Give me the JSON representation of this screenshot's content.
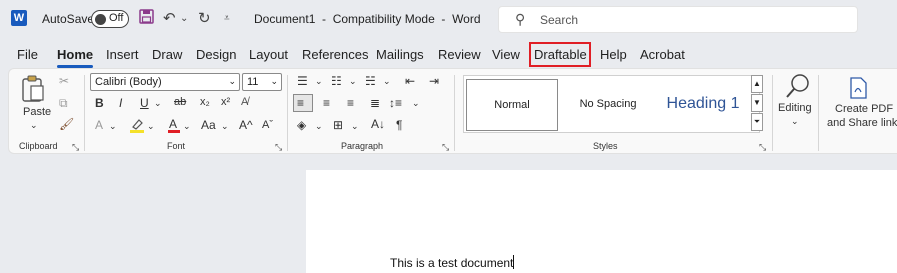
{
  "titlebar": {
    "app_icon_letter": "W",
    "autosave_label": "AutoSave",
    "autosave_state": "Off",
    "document_title": "Document1  -  Compatibility Mode  -  Word",
    "search_placeholder": "Search"
  },
  "tabs": [
    "File",
    "Home",
    "Insert",
    "Draw",
    "Design",
    "Layout",
    "References",
    "Mailings",
    "Review",
    "View",
    "Draftable",
    "Help",
    "Acrobat"
  ],
  "active_tab": "Home",
  "highlighted_tab": "Draftable",
  "ribbon": {
    "clipboard": {
      "paste_label": "Paste",
      "group_label": "Clipboard"
    },
    "font": {
      "font_name": "Calibri (Body)",
      "font_size": "11",
      "group_label": "Font"
    },
    "paragraph": {
      "group_label": "Paragraph"
    },
    "styles": {
      "items": [
        "Normal",
        "No Spacing",
        "Heading 1"
      ],
      "selected": "Normal",
      "group_label": "Styles"
    },
    "editing": {
      "label": "Editing"
    },
    "acrobat": {
      "label_line1": "Create PDF",
      "label_line2": "and Share link"
    }
  },
  "document": {
    "text": "This is a test document"
  },
  "colors": {
    "accent": "#185abd",
    "highlight_border": "#e01e25"
  }
}
